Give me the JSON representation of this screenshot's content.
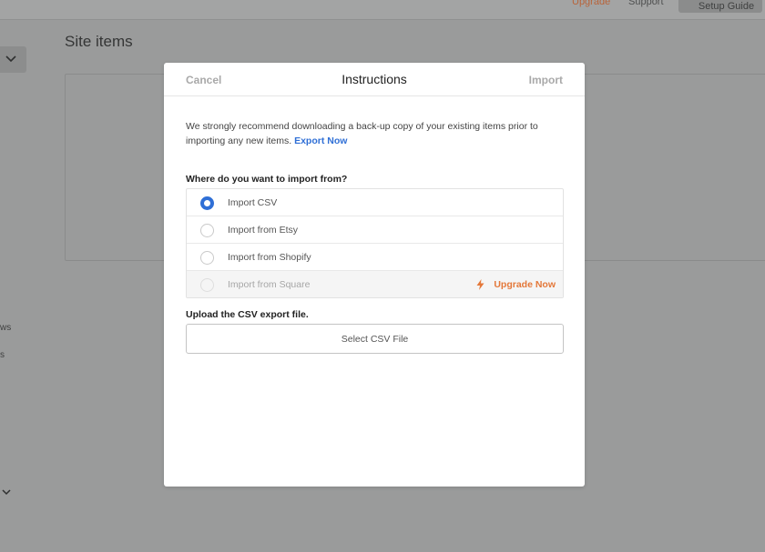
{
  "top_nav": {
    "upgrade": "Upgrade",
    "support": "Support",
    "setup_guide": "Setup Guide"
  },
  "background": {
    "page_title": "Site items",
    "left_fragment_1": "ws",
    "left_fragment_2": "s"
  },
  "modal": {
    "cancel": "Cancel",
    "title": "Instructions",
    "import": "Import",
    "intro_text": "We strongly recommend downloading a back-up copy of your existing items prior to importing any new items.",
    "export_link": "Export Now",
    "source_question": "Where do you want to import from?",
    "options": [
      {
        "label": "Import CSV",
        "selected": true,
        "disabled": false
      },
      {
        "label": "Import from Etsy",
        "selected": false,
        "disabled": false
      },
      {
        "label": "Import from Shopify",
        "selected": false,
        "disabled": false
      },
      {
        "label": "Import from Square",
        "selected": false,
        "disabled": true,
        "badge": "Upgrade Now"
      }
    ],
    "upload_label": "Upload the CSV export file.",
    "select_file_button": "Select CSV File"
  },
  "colors": {
    "accent_blue": "#2f6fd6",
    "upgrade_orange": "#e4783a",
    "overlay_gray": "#9a9b9b"
  },
  "icons": {
    "dropdown": "chevron-down-icon",
    "upgrade": "lightning-bolt-icon"
  }
}
